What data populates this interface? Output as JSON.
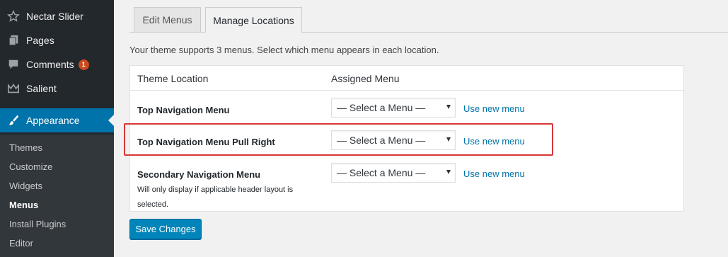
{
  "sidebar": {
    "items": [
      {
        "label": "Nectar Slider",
        "icon": "star-icon"
      },
      {
        "label": "Pages",
        "icon": "pages-icon"
      },
      {
        "label": "Comments",
        "icon": "comments-icon",
        "badge": "1"
      },
      {
        "label": "Salient",
        "icon": "crown-icon"
      },
      {
        "label": "Appearance",
        "icon": "paintbrush-icon"
      }
    ],
    "submenu": [
      {
        "label": "Themes"
      },
      {
        "label": "Customize"
      },
      {
        "label": "Widgets"
      },
      {
        "label": "Menus"
      },
      {
        "label": "Install Plugins"
      },
      {
        "label": "Editor"
      }
    ]
  },
  "tabs": [
    {
      "label": "Edit Menus"
    },
    {
      "label": "Manage Locations"
    }
  ],
  "intro_text": "Your theme supports 3 menus. Select which menu appears in each location.",
  "table": {
    "headers": {
      "location": "Theme Location",
      "menu": "Assigned Menu"
    },
    "rows": [
      {
        "location": "Top Navigation Menu",
        "select": "— Select a Menu —",
        "link": "Use new menu"
      },
      {
        "location": "Top Navigation Menu Pull Right",
        "select": "— Select a Menu —",
        "link": "Use new menu"
      },
      {
        "location": "Secondary Navigation Menu",
        "description": "Will only display if applicable header layout is selected.",
        "select": "— Select a Menu —",
        "link": "Use new menu"
      }
    ]
  },
  "save_button": "Save Changes",
  "colors": {
    "sidebar": "#23282d",
    "active": "#0073aa",
    "link": "#0073aa",
    "highlight": "#d93636",
    "badge": "#ca4a1f"
  }
}
